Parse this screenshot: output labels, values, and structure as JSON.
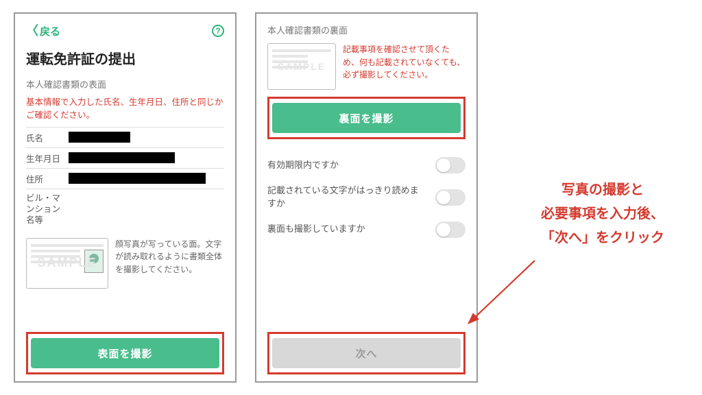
{
  "nav": {
    "back_label": "戻る"
  },
  "left": {
    "title": "運転免許証の提出",
    "section_label": "本人確認書類の表面",
    "red_note": "基本情報で入力した氏名、生年月日、住所と同じかご確認ください。",
    "rows": {
      "name_label": "氏名",
      "dob_label": "生年月日",
      "address_label": "住所",
      "building_label": "ビル・マンション名等"
    },
    "sample_watermark": "SAMPLE",
    "sample_text": "顔写真が写っている面。文字が読み取れるように書類全体を撮影してください。",
    "button_label": "表面を撮影"
  },
  "right": {
    "section_label": "本人確認書類の裏面",
    "sample_watermark": "SAMPLE",
    "sample_text": "記載事項を確認させて頂くため、何も記載されていなくても、必ず撮影してください。",
    "button_label": "裏面を撮影",
    "checks": {
      "c1": "有効期限内ですか",
      "c2": "記載されている文字がはっきり読めますか",
      "c3": "裏面も撮影していますか"
    },
    "next_label": "次へ"
  },
  "annotation": "写真の撮影と\n必要事項を入力後、\n「次へ」をクリック"
}
